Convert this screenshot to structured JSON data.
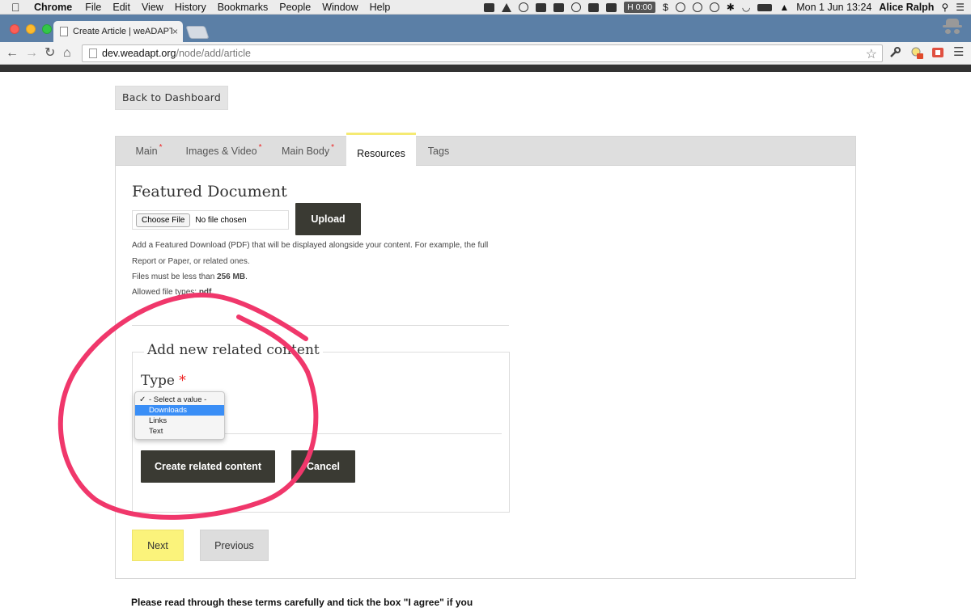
{
  "menubar": {
    "app_name": "Chrome",
    "menus": [
      "File",
      "Edit",
      "View",
      "History",
      "Bookmarks",
      "People",
      "Window",
      "Help"
    ],
    "timer_badge": "0:00",
    "clock": "Mon 1 Jun  13:24",
    "user": "Alice Ralph"
  },
  "browser": {
    "tab_title": "Create Article | weADAPT",
    "tab_close": "×",
    "url_host": "dev.weadapt.org",
    "url_path": "/node/add/article"
  },
  "page": {
    "back_button": "Back to Dashboard",
    "tabs": [
      {
        "label": "Main",
        "required": true
      },
      {
        "label": "Images & Video",
        "required": true
      },
      {
        "label": "Main Body",
        "required": true
      },
      {
        "label": "Resources",
        "required": false,
        "active": true
      },
      {
        "label": "Tags",
        "required": false
      }
    ],
    "required_mark": "*",
    "featured_document": {
      "title": "Featured Document",
      "choose_file": "Choose File",
      "no_file": "No file chosen",
      "upload": "Upload",
      "help_line1": "Add a Featured Download (PDF) that will be displayed alongside your content. For example, the full",
      "help_line2": "Report or Paper, or related ones.",
      "size_prefix": "Files must be less than ",
      "size_value": "256 MB",
      "size_suffix": ".",
      "types_prefix": "Allowed file types: ",
      "types_value": "pdf",
      "types_suffix": "."
    },
    "related": {
      "legend": "Add new related content",
      "type_label": "Type",
      "options": [
        "- Select a value -",
        "Downloads",
        "Links",
        "Text"
      ],
      "checked_option": "- Select a value -",
      "highlighted_option": "Downloads",
      "create_button": "Create related content",
      "cancel_button": "Cancel"
    },
    "next_button": "Next",
    "previous_button": "Previous",
    "terms_text": "Please read through these terms carefully and tick the box \"I agree\" if you"
  },
  "annotation": {
    "color": "#f0376b"
  }
}
